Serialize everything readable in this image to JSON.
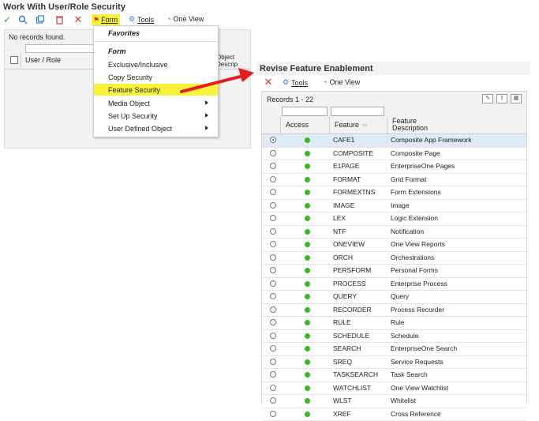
{
  "left_window": {
    "title": "Work With User/Role Security",
    "toolbar": {
      "form_label": "Form",
      "tools_label": "Tools",
      "one_view_label": "One View"
    },
    "no_records": "No records found.",
    "columns": {
      "user_role": "User / Role",
      "object_desc": "Object\nDescrip"
    }
  },
  "form_menu": {
    "items": [
      {
        "label": "Favorites",
        "style": "header"
      },
      {
        "label": "Form",
        "style": "header"
      },
      {
        "label": "Exclusive/Inclusive"
      },
      {
        "label": "Copy Security"
      },
      {
        "label": "Feature Security",
        "highlighted": true
      },
      {
        "label": "Media Object",
        "submenu": true
      },
      {
        "label": "Set Up Security",
        "submenu": true
      },
      {
        "label": "User Defined Object",
        "submenu": true
      }
    ]
  },
  "right_window": {
    "title": "Revise Feature Enablement",
    "toolbar": {
      "tools_label": "Tools",
      "one_view_label": "One View"
    },
    "records_count": "Records 1 - 22",
    "columns": {
      "access": "Access",
      "feature": "Feature",
      "description": "Feature\nDescription"
    },
    "rows": [
      {
        "feature": "CAFE1",
        "description": "Composite App Framework",
        "selected": true
      },
      {
        "feature": "COMPOSITE",
        "description": "Composite Page"
      },
      {
        "feature": "E1PAGE",
        "description": "EnterpriseOne Pages"
      },
      {
        "feature": "FORMAT",
        "description": "Grid Format"
      },
      {
        "feature": "FORMEXTNS",
        "description": "Form Extensions"
      },
      {
        "feature": "IMAGE",
        "description": "Image"
      },
      {
        "feature": "LEX",
        "description": "Logic Extension"
      },
      {
        "feature": "NTF",
        "description": "Notification"
      },
      {
        "feature": "ONEVIEW",
        "description": "One View Reports"
      },
      {
        "feature": "ORCH",
        "description": "Orchestrations"
      },
      {
        "feature": "PERSFORM",
        "description": "Personal Forms"
      },
      {
        "feature": "PROCESS",
        "description": "Enterprise Process"
      },
      {
        "feature": "QUERY",
        "description": "Query"
      },
      {
        "feature": "RECORDER",
        "description": "Process Recorder"
      },
      {
        "feature": "RULE",
        "description": "Rule"
      },
      {
        "feature": "SCHEDULE",
        "description": "Schedule"
      },
      {
        "feature": "SEARCH",
        "description": "EnterpriseOne Search"
      },
      {
        "feature": "SREQ",
        "description": "Service Requests"
      },
      {
        "feature": "TASKSEARCH",
        "description": "Task Search"
      },
      {
        "feature": "WATCHLIST",
        "description": "One View Watchlist"
      },
      {
        "feature": "WLST",
        "description": "Whitelist"
      },
      {
        "feature": "XREF",
        "description": "Cross Reference"
      }
    ]
  },
  "colors": {
    "highlight": "#f7f23a",
    "access_enabled": "#3cb61e",
    "arrow": "#e41b1b",
    "selected_row": "#dfeaf6"
  }
}
